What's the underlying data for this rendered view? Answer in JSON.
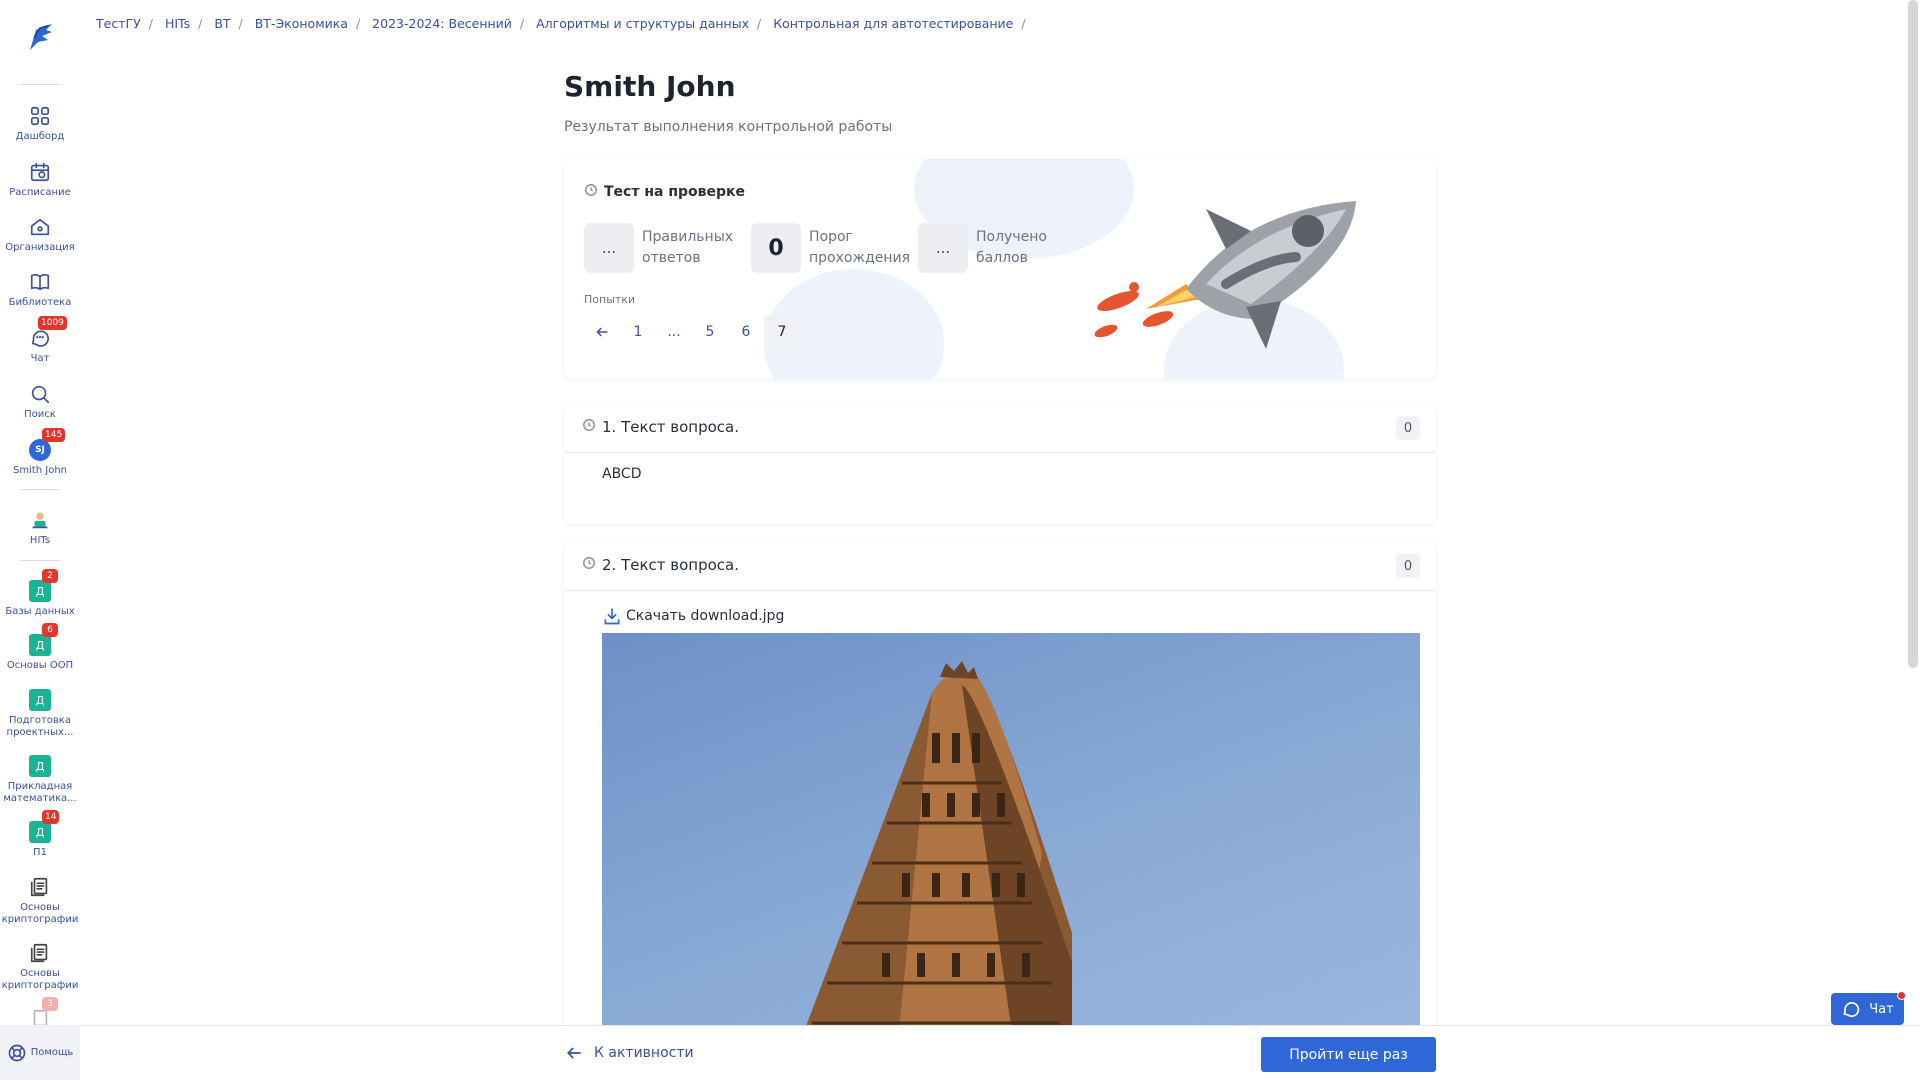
{
  "breadcrumb": [
    "ТестГУ",
    "HITs",
    "ВТ",
    "ВТ-Экономика",
    "2023-2024: Весенний",
    "Алгоритмы и структуры данных",
    "Контрольная для автотестирование"
  ],
  "sidebar": {
    "items": [
      {
        "label": "Дашборд",
        "icon": "dashboard-icon"
      },
      {
        "label": "Расписание",
        "icon": "schedule-icon"
      },
      {
        "label": "Организация",
        "icon": "organization-icon"
      },
      {
        "label": "Библиотека",
        "icon": "library-icon"
      },
      {
        "label": "Чат",
        "icon": "chat-icon",
        "badge": "1009"
      },
      {
        "label": "Поиск",
        "icon": "search-icon"
      },
      {
        "label": "Smith John",
        "avatar": "SJ",
        "badge": "145"
      },
      {
        "label": "HITs",
        "icon": "hits-icon"
      },
      {
        "label": "Базы данных",
        "square": "Д",
        "badge": "2"
      },
      {
        "label": "Основы ООП",
        "square": "Д",
        "badge": "6"
      },
      {
        "label": "Подготовка проектных...",
        "square": "Д"
      },
      {
        "label": "Прикладная математика...",
        "square": "Д"
      },
      {
        "label": "П1",
        "square": "Д",
        "badge": "14"
      },
      {
        "label": "Основы криптографии",
        "icon": "document-icon"
      },
      {
        "label": "Основы криптографии",
        "icon": "document-icon"
      },
      {
        "badge": "3"
      }
    ],
    "help_label": "Помощь"
  },
  "page": {
    "title": "Smith John",
    "subtitle": "Результат выполнения контрольной работы"
  },
  "status_card": {
    "status": "Тест на проверке",
    "stats": [
      {
        "value": "...",
        "label": "Правильных ответов"
      },
      {
        "value": "0",
        "label": "Порог прохождения"
      },
      {
        "value": "...",
        "label": "Получено баллов"
      }
    ],
    "attempts_label": "Попытки",
    "pages": [
      "1",
      "...",
      "5",
      "6",
      "7"
    ],
    "active_page": "7"
  },
  "questions": [
    {
      "title": "1. Текст вопроса.",
      "score": "0",
      "answer": "ABCD"
    },
    {
      "title": "2. Текст вопроса.",
      "score": "0",
      "download_label": "Скачать download.jpg"
    }
  ],
  "bottom": {
    "back_label": "К активности",
    "retry_label": "Пройти еще раз"
  },
  "chat_widget": {
    "label": "Чат"
  },
  "colors": {
    "accent": "#2f67d9",
    "nav": "#3d4fa1",
    "badge": "#e2362b",
    "course": "#1cb394"
  }
}
